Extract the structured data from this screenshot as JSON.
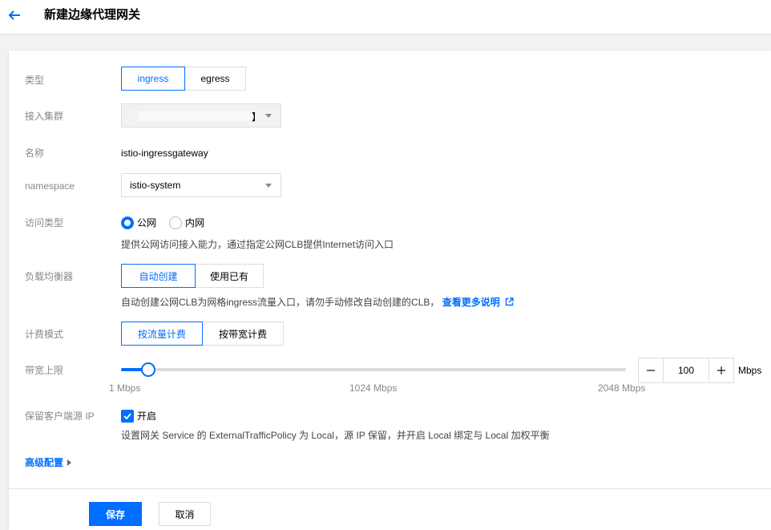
{
  "header": {
    "title": "新建边缘代理网关",
    "back_icon": "arrow-left-icon"
  },
  "form": {
    "type": {
      "label": "类型",
      "options": [
        "ingress",
        "egress"
      ],
      "selected": "ingress"
    },
    "cluster": {
      "label": "接入集群",
      "value": "】"
    },
    "name": {
      "label": "名称",
      "value": "istio-ingressgateway"
    },
    "namespace": {
      "label": "namespace",
      "value": "istio-system"
    },
    "access_type": {
      "label": "访问类型",
      "options": [
        "公网",
        "内网"
      ],
      "selected": "公网",
      "help": "提供公网访问接入能力，通过指定公网CLB提供Internet访问入口"
    },
    "load_balancer": {
      "label": "负载均衡器",
      "options": [
        "自动创建",
        "使用已有"
      ],
      "selected": "自动创建",
      "help": "自动创建公网CLB为网格ingress流量入口，请勿手动修改自动创建的CLB，",
      "help_link": "查看更多说明",
      "link_icon": "external-link-icon"
    },
    "billing": {
      "label": "计费模式",
      "options": [
        "按流量计费",
        "按带宽计费"
      ],
      "selected": "按流量计费"
    },
    "bandwidth": {
      "label": "带宽上限",
      "min_label": "1 Mbps",
      "mid_label": "1024 Mbps",
      "max_label": "2048 Mbps",
      "min": 1,
      "max": 2048,
      "value": 100,
      "value_text": "100",
      "unit": "Mbps",
      "minus": "−",
      "plus": "+"
    },
    "preserve_ip": {
      "label": "保留客户端源 IP",
      "checkbox_label": "开启",
      "checked": true,
      "help": "设置网关 Service 的 ExternalTrafficPolicy 为 Local，源 IP 保留，并开启 Local 绑定与 Local 加权平衡"
    },
    "advanced": "高级配置"
  },
  "footer": {
    "save": "保存",
    "cancel": "取消"
  },
  "colors": {
    "accent": "#006eff"
  }
}
